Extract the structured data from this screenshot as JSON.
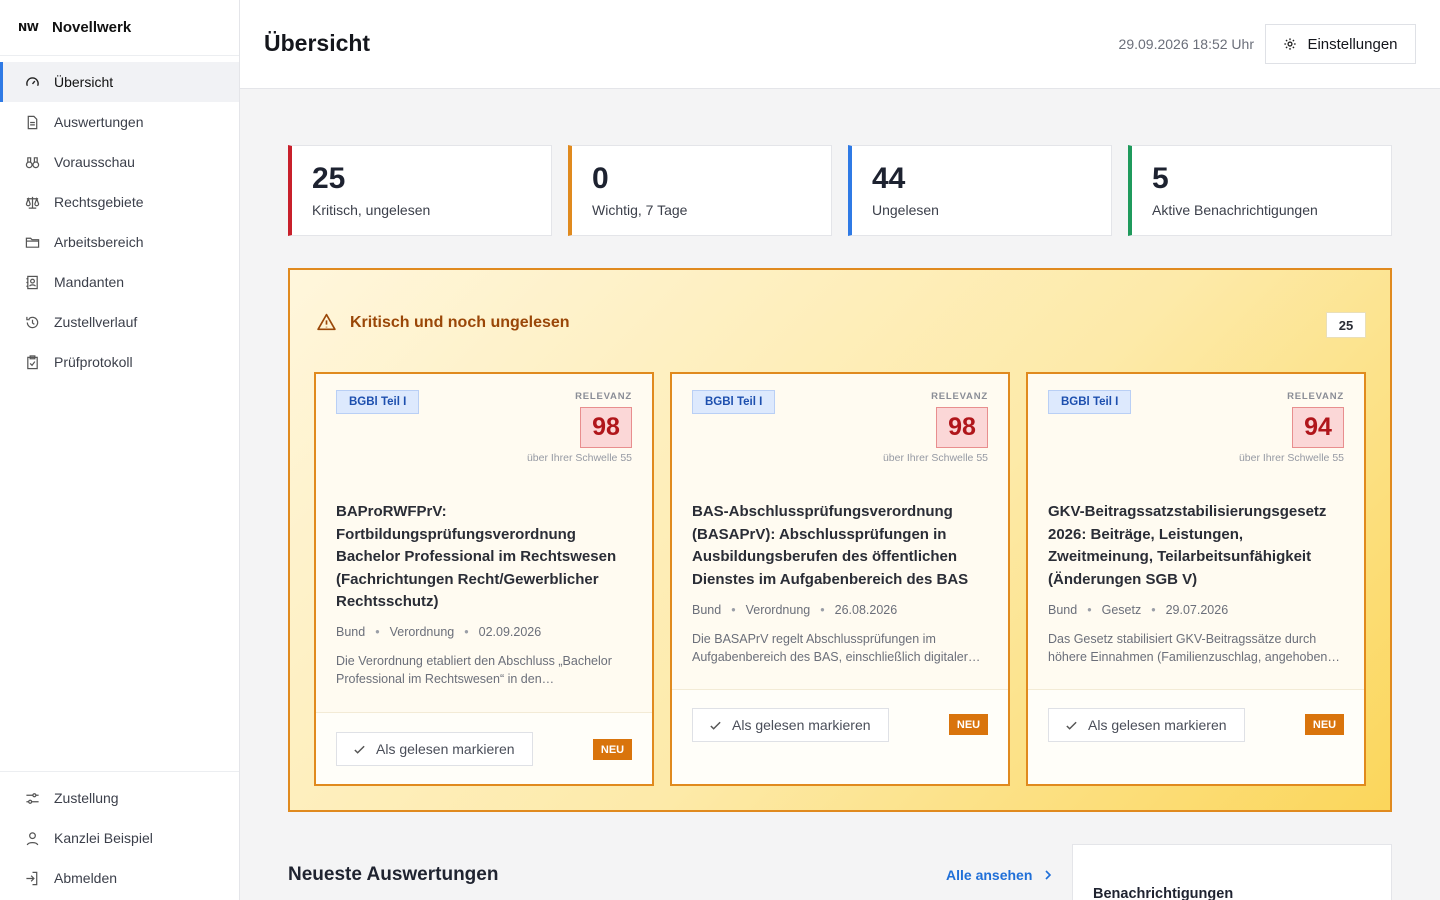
{
  "brand": {
    "logo": "NW",
    "name": "Novellwerk"
  },
  "sidebar": {
    "items": [
      {
        "label": "Übersicht",
        "icon": "gauge-icon",
        "active": true
      },
      {
        "label": "Auswertungen",
        "icon": "document-icon"
      },
      {
        "label": "Vorausschau",
        "icon": "binoculars-icon"
      },
      {
        "label": "Rechtsgebiete",
        "icon": "scale-icon"
      },
      {
        "label": "Arbeitsbereich",
        "icon": "folder-icon"
      },
      {
        "label": "Mandanten",
        "icon": "contact-book-icon"
      },
      {
        "label": "Zustellverlauf",
        "icon": "history-icon"
      },
      {
        "label": "Prüfprotokoll",
        "icon": "clipboard-icon"
      }
    ],
    "bottom_items": [
      {
        "label": "Zustellung",
        "icon": "sliders-icon"
      },
      {
        "label": "Kanzlei Beispiel",
        "icon": "user-icon"
      },
      {
        "label": "Abmelden",
        "icon": "logout-icon"
      }
    ]
  },
  "header": {
    "title": "Übersicht",
    "datetime": "29.09.2026 18:52 Uhr",
    "settings_label": "Einstellungen"
  },
  "stats": [
    {
      "value": "25",
      "label": "Kritisch, ungelesen",
      "color": "#c8202b"
    },
    {
      "value": "0",
      "label": "Wichtig, 7 Tage",
      "color": "#e08a1e"
    },
    {
      "value": "44",
      "label": "Ungelesen",
      "color": "#2f7ae5"
    },
    {
      "value": "5",
      "label": "Aktive Benachrichtigungen",
      "color": "#1f9a5c"
    }
  ],
  "critical": {
    "title": "Kritisch und noch ungelesen",
    "count": "25",
    "relevance_label": "RELEVANZ",
    "mark_read_label": "Als gelesen markieren",
    "new_badge": "NEU",
    "cards": [
      {
        "tag": "BGBl Teil I",
        "score": "98",
        "threshold": "über Ihrer Schwelle 55",
        "title": "BAProRWFPrV: Fortbildungsprüfungsverordnung Bachelor Professional im Rechtswesen (Fachrichtungen Recht/Gewerblicher Rechtsschutz)",
        "jurisdiction": "Bund",
        "type": "Verordnung",
        "date": "02.09.2026",
        "description": "Die Verordnung etabliert den Abschluss „Bachelor Professional im Rechtswesen“ in den…"
      },
      {
        "tag": "BGBl Teil I",
        "score": "98",
        "threshold": "über Ihrer Schwelle 55",
        "title": "BAS-Abschlussprüfungsverordnung (BASAPrV): Abschlussprüfungen in Ausbildungsberufen des öffentlichen Dienstes im Aufgabenbereich des BAS",
        "jurisdiction": "Bund",
        "type": "Verordnung",
        "date": "26.08.2026",
        "description": "Die BASAPrV regelt Abschlussprüfungen im Aufgabenbereich des BAS, einschließlich digitaler…"
      },
      {
        "tag": "BGBl Teil I",
        "score": "94",
        "threshold": "über Ihrer Schwelle 55",
        "title": "GKV-Beitragssatzstabilisierungsgesetz 2026: Beiträge, Leistungen, Zweitmeinung, Teilarbeitsunfähigkeit (Änderungen SGB V)",
        "jurisdiction": "Bund",
        "type": "Gesetz",
        "date": "29.07.2026",
        "description": "Das Gesetz stabilisiert GKV-Beitragssätze durch höhere Einnahmen (Familienzuschlag, angehoben…"
      }
    ]
  },
  "latest": {
    "title": "Neueste Auswertungen",
    "see_all": "Alle ansehen"
  },
  "notifications": {
    "title": "Benachrichtigungen"
  }
}
